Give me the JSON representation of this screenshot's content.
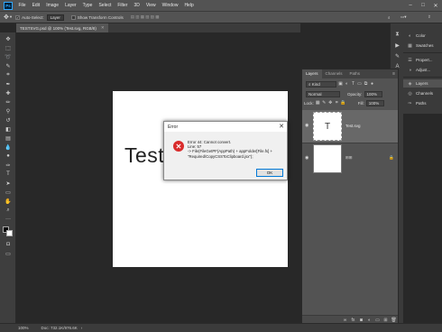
{
  "menubar": {
    "logo": "Ps",
    "items": [
      "File",
      "Edit",
      "Image",
      "Layer",
      "Type",
      "Select",
      "Filter",
      "3D",
      "View",
      "Window",
      "Help"
    ],
    "window_controls": {
      "minimize": "–",
      "maximize": "□",
      "close": "✕"
    }
  },
  "options_bar": {
    "auto_select_label": "Auto-Select:",
    "auto_select_value": "Layer",
    "show_transform_label": "Show Transform Controls"
  },
  "document": {
    "tab_title": "TESTSVG.psd @ 100% (Test.svg, RGB/8)",
    "canvas_text": "Test"
  },
  "status_bar": {
    "zoom": "100%",
    "doc_info": "Doc: 732.1K/976.6K"
  },
  "right_panels": {
    "items": [
      {
        "label": "Color",
        "icon": "color-wheel-icon"
      },
      {
        "label": "Swatches",
        "icon": "swatches-icon"
      },
      {
        "label": "Propert...",
        "icon": "properties-icon"
      },
      {
        "label": "Adjust...",
        "icon": "adjustments-icon"
      },
      {
        "label": "Layers",
        "icon": "layers-icon"
      },
      {
        "label": "Channels",
        "icon": "channels-icon"
      },
      {
        "label": "Paths",
        "icon": "paths-icon"
      }
    ]
  },
  "layers_panel": {
    "tabs": [
      "Layers",
      "Channels",
      "Paths"
    ],
    "filter_label": "Kind",
    "blend_mode": "Normal",
    "opacity_label": "Opacity:",
    "opacity_value": "100%",
    "lock_label": "Lock:",
    "fill_label": "Fill:",
    "fill_value": "100%",
    "layers": [
      {
        "name": "Test.svg",
        "thumb_glyph": "T",
        "selected": true
      },
      {
        "name": "",
        "thumb_glyph": "",
        "selected": false
      }
    ]
  },
  "error_dialog": {
    "title": "Error",
    "message": "Error 44: Cannot convert.\nLine: 57\n->       File(FileGetPF(AppPath) + appFolder[File.fs] +\n\"Required/CopyCSSToClipboard.jsx\");",
    "ok_label": "OK"
  }
}
